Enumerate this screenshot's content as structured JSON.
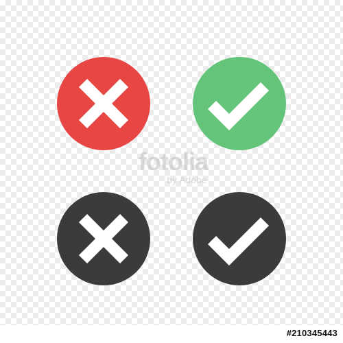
{
  "icons": [
    {
      "name": "cross",
      "style": "red",
      "color": "#e84545"
    },
    {
      "name": "check",
      "style": "green",
      "color": "#63c47a"
    },
    {
      "name": "cross",
      "style": "dark",
      "color": "#3b3b3e"
    },
    {
      "name": "check",
      "style": "dark",
      "color": "#3b3b3e"
    }
  ],
  "watermark": {
    "brand": "fotolia",
    "by": "by Adobe"
  },
  "stock_id": "#210345443",
  "colors": {
    "red": "#e84545",
    "green": "#63c47a",
    "dark": "#3b3b3e",
    "mark": "#ffffff"
  }
}
